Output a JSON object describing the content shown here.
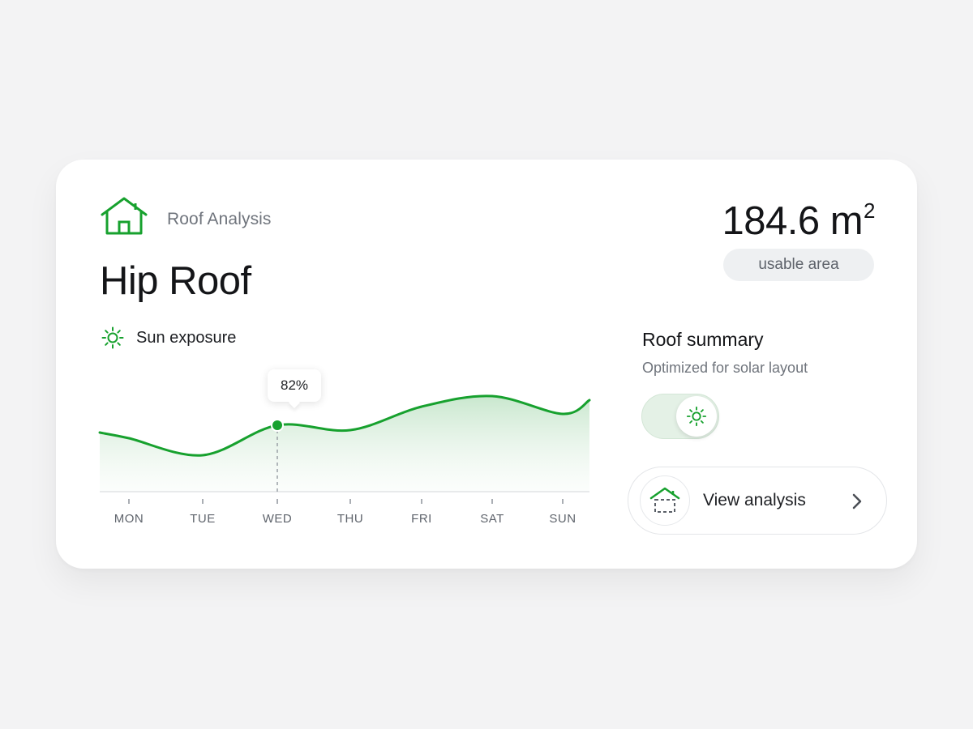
{
  "header": {
    "eyebrow": "Roof Analysis",
    "title": "Hip Roof"
  },
  "area": {
    "value": "184.6 m",
    "unit_sup": "2",
    "badge": "usable area"
  },
  "sun": {
    "label": "Sun exposure"
  },
  "chart_data": {
    "type": "area",
    "categories": [
      "MON",
      "TUE",
      "WED",
      "THU",
      "FRI",
      "SAT",
      "SUN"
    ],
    "highlight": {
      "category": "WED",
      "label": "82%"
    },
    "series": [
      {
        "values": [
          66,
          45,
          82,
          76,
          105,
          118,
          96
        ]
      }
    ],
    "colors": {
      "line": "#17a12e",
      "fill": "#cfe9d3"
    }
  },
  "summary": {
    "title": "Roof summary",
    "subtitle": "Optimized for solar layout",
    "toggle_on": true
  },
  "action": {
    "label": "View analysis",
    "icon": "house-layout-icon",
    "chevron": "chevron-right-icon"
  },
  "colors": {
    "accent": "#17a12e",
    "background": "#f3f3f4",
    "card": "#ffffff",
    "text": "#141518",
    "muted": "#6f747c"
  }
}
